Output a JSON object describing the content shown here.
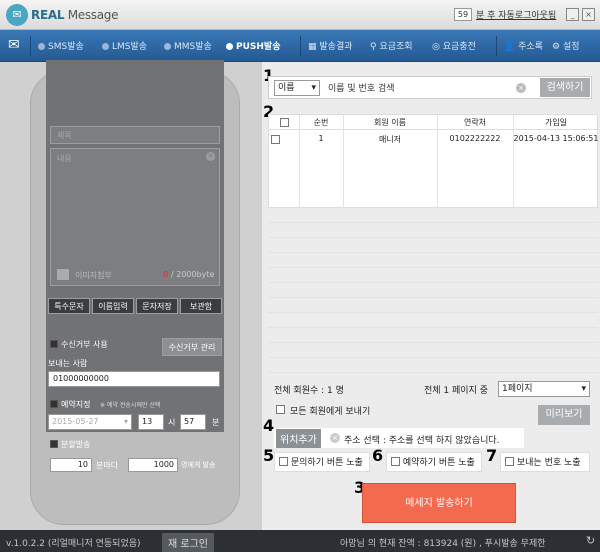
{
  "title_bar": {
    "logo_icon": "envelope-icon",
    "logo_brand": "REAL",
    "logo_word": "Message",
    "auto_logout_count": "59",
    "auto_logout_text": "분 후 자동로그아웃됨",
    "min_label": "_",
    "close_label": "×"
  },
  "nav": {
    "items": [
      {
        "label": "SMS발송",
        "active": false
      },
      {
        "label": "LMS발송",
        "active": false
      },
      {
        "label": "MMS발송",
        "active": false
      },
      {
        "label": "PUSH발송",
        "active": true
      }
    ],
    "right_items": [
      {
        "label": "발송결과",
        "icon": "chart-icon"
      },
      {
        "label": "요금조회",
        "icon": "search-icon"
      },
      {
        "label": "요금충전",
        "icon": "coin-icon"
      },
      {
        "label": "주소록",
        "icon": "person-icon"
      },
      {
        "label": "설정",
        "icon": "gear-icon"
      }
    ]
  },
  "phone": {
    "title_placeholder": "제목",
    "content_placeholder": "내용",
    "image_attach": "이미지첨부",
    "byte_count": "0",
    "byte_max": "/ 2000byte",
    "buttons": [
      "특수문자",
      "이름입력",
      "문자저장",
      "보관함"
    ],
    "reject_use": "수신거부 사용",
    "reject_manage": "수신거부 관리",
    "sender_label": "보내는 사람",
    "sender_value": "01000000000",
    "reserve_label": "예약지정",
    "reserve_note": "※ 예약 전송시에만 선택",
    "reserve_date": "2015-05-27",
    "reserve_hour": "13",
    "hour_unit": "시",
    "reserve_min": "57",
    "min_unit": "분",
    "split_label": "분할발송",
    "split_minutes": "10",
    "split_min_unit": "분마다",
    "split_count": "1000",
    "split_count_unit": "명에게 발송"
  },
  "badges": {
    "b1": "1",
    "b2": "2",
    "b3": "3",
    "b4": "4",
    "b5": "5",
    "b6": "6",
    "b7": "7"
  },
  "search": {
    "select_value": "이름",
    "input_value": "이름 및 번호 검색",
    "button": "검색하기"
  },
  "table": {
    "headers": [
      "순번",
      "회원 이름",
      "연락처",
      "가입일"
    ],
    "rows": [
      {
        "no": "1",
        "name": "매니저",
        "phone": "0102222222",
        "date": "2015-04-13 15:06:51"
      }
    ]
  },
  "summary": {
    "total_members": "전체 회원수 : 1 명",
    "total_pages": "전체 1 페이지 중",
    "page_select": "1페이지",
    "send_all": "모든 회원에게 보내기",
    "preview": "미리보기"
  },
  "location": {
    "button": "위치추가",
    "text": "주소 선택 : 주소를 선택 하지 않았습니다."
  },
  "options": {
    "inquiry": "문의하기 버튼 노출",
    "reserve": "예약하기 버튼 노출",
    "sender": "보내는 번호 노출"
  },
  "send_button": "메세지 발송하기",
  "footer": {
    "version": "v.1.0.2.2 (리얼매니저 연동되었음)",
    "relogin": "재 로그인",
    "balance": "아망님 의 현재 잔액 : 813924 (원) , 푸시발송 무제한"
  },
  "colors": {
    "accent": "#f36a4f",
    "nav": "#2f69a6",
    "badge_text": "#000000"
  }
}
